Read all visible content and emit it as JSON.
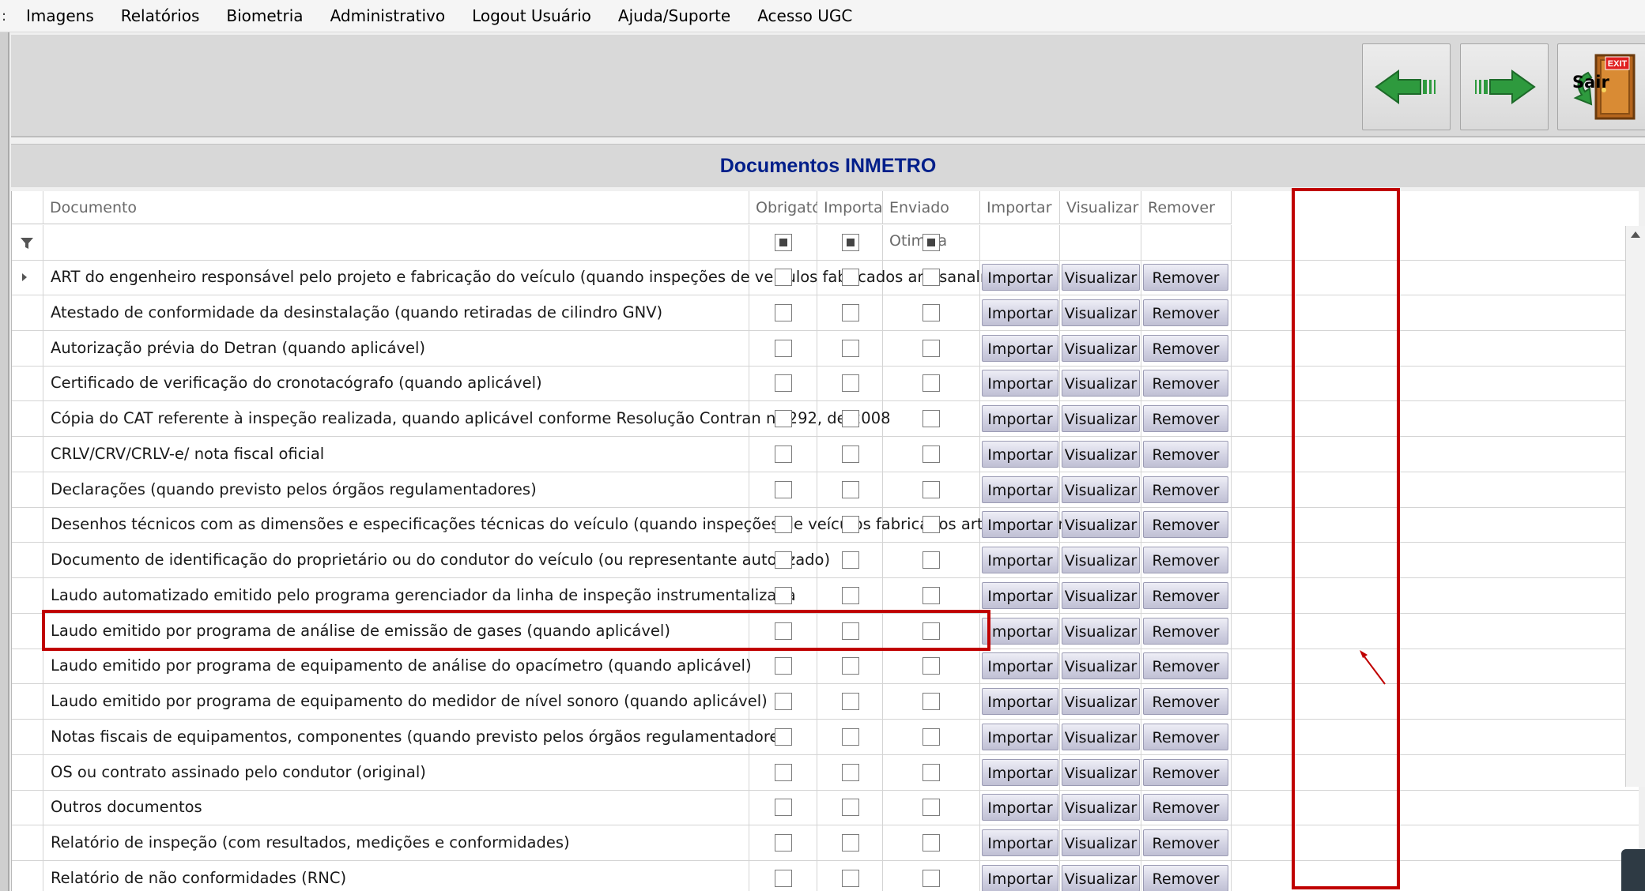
{
  "menu": [
    "Imagens",
    "Relatórios",
    "Biometria",
    "Administrativo",
    "Logout Usuário",
    "Ajuda/Suporte",
    "Acesso UGC"
  ],
  "toolbar": {
    "exit_label": "Sair",
    "exit_sign": "EXIT"
  },
  "section_title": "Documentos INMETRO",
  "columns": [
    "Documento",
    "Obrigatório",
    "Importado",
    "Enviado Otimiza",
    "Importar",
    "Visualizar",
    "Remover"
  ],
  "buttons": {
    "import": "Importar",
    "view": "Visualizar",
    "remove": "Remover"
  },
  "rows": [
    "ART do engenheiro responsável pelo projeto e fabricação do veículo (quando inspeções de veículos fabricados artesanalmente)",
    "Atestado de conformidade da desinstalação (quando retiradas de cilindro GNV)",
    "Autorização prévia do Detran (quando aplicável)",
    "Certificado de verificação do cronotacógrafo (quando aplicável)",
    "Cópia do CAT referente à inspeção realizada, quando aplicável conforme Resolução Contran nº 292, de 2008",
    "CRLV/CRV/CRLV-e/ nota fiscal oficial",
    "Declarações (quando previsto pelos órgãos regulamentadores)",
    "Desenhos técnicos com as dimensões e especificações técnicas do veículo (quando inspeções de veículos fabricados artesanalmente)",
    "Documento de identificação do proprietário ou do condutor do veículo (ou representante autorizado)",
    "Laudo automatizado emitido pelo programa gerenciador da linha de inspeção instrumentalizada",
    "Laudo emitido por programa de análise de emissão de gases (quando aplicável)",
    "Laudo emitido por programa de equipamento de análise do opacímetro (quando aplicável)",
    "Laudo emitido por programa de equipamento do medidor de nível sonoro (quando aplicável)",
    "Notas fiscais de equipamentos, componentes (quando previsto pelos órgãos regulamentadores)",
    "OS ou contrato assinado pelo condutor (original)",
    "Outros documentos",
    "Relatório de inspeção (com resultados, medições e conformidades)",
    "Relatório de não conformidades (RNC)"
  ],
  "colors": {
    "highlight": "#c00000",
    "title": "#001f8a",
    "arrow_green": "#2e9a3e"
  }
}
